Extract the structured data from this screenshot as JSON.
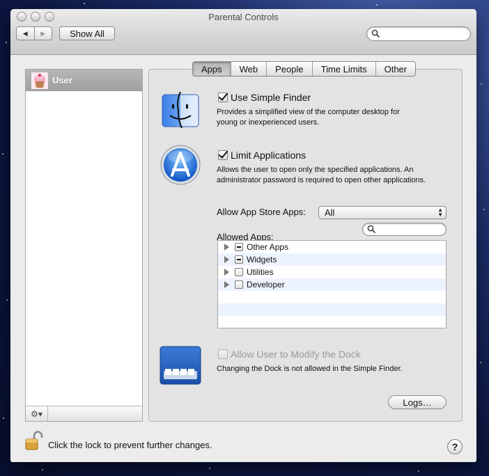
{
  "window": {
    "title": "Parental Controls"
  },
  "toolbar": {
    "back_glyph": "◀",
    "forward_glyph": "▶",
    "show_all_label": "Show All",
    "search_placeholder": "",
    "search_value": ""
  },
  "sidebar": {
    "users": [
      {
        "name": "User",
        "selected": true
      }
    ],
    "gear_label": "⚙▾"
  },
  "tabs": [
    {
      "label": "Apps",
      "active": true
    },
    {
      "label": "Web",
      "active": false
    },
    {
      "label": "People",
      "active": false
    },
    {
      "label": "Time Limits",
      "active": false
    },
    {
      "label": "Other",
      "active": false
    }
  ],
  "apps": {
    "simple_finder": {
      "label": "Use Simple Finder",
      "checked": true,
      "desc_line1": "Provides a simplified view of the computer desktop for",
      "desc_line2": "young or inexperienced users."
    },
    "limit_apps": {
      "label": "Limit Applications",
      "checked": true,
      "desc_line1": "Allows the user to open only the specified applications. An",
      "desc_line2": "administrator password is required to open other applications."
    },
    "app_store": {
      "label": "Allow App Store Apps:",
      "selected": "All"
    },
    "allowed_apps": {
      "label": "Allowed Apps:",
      "search_value": "",
      "items": [
        {
          "label": "Other Apps",
          "state": "mixed"
        },
        {
          "label": "Widgets",
          "state": "mixed"
        },
        {
          "label": "Utilities",
          "state": "unchecked"
        },
        {
          "label": "Developer",
          "state": "unchecked"
        }
      ]
    },
    "dock": {
      "label": "Allow User to Modify the Dock",
      "checked": false,
      "enabled": false,
      "desc": "Changing the Dock is not allowed in the Simple Finder."
    },
    "logs_label": "Logs…"
  },
  "footer": {
    "lock_text": "Click the lock to prevent further changes.",
    "help_label": "?"
  },
  "colors": {
    "selection_gray": "#a8a8a8",
    "list_stripe": "#edf3fe",
    "app_store_blue": "#1a6fe0",
    "finder_blue": "#3d7de4"
  }
}
